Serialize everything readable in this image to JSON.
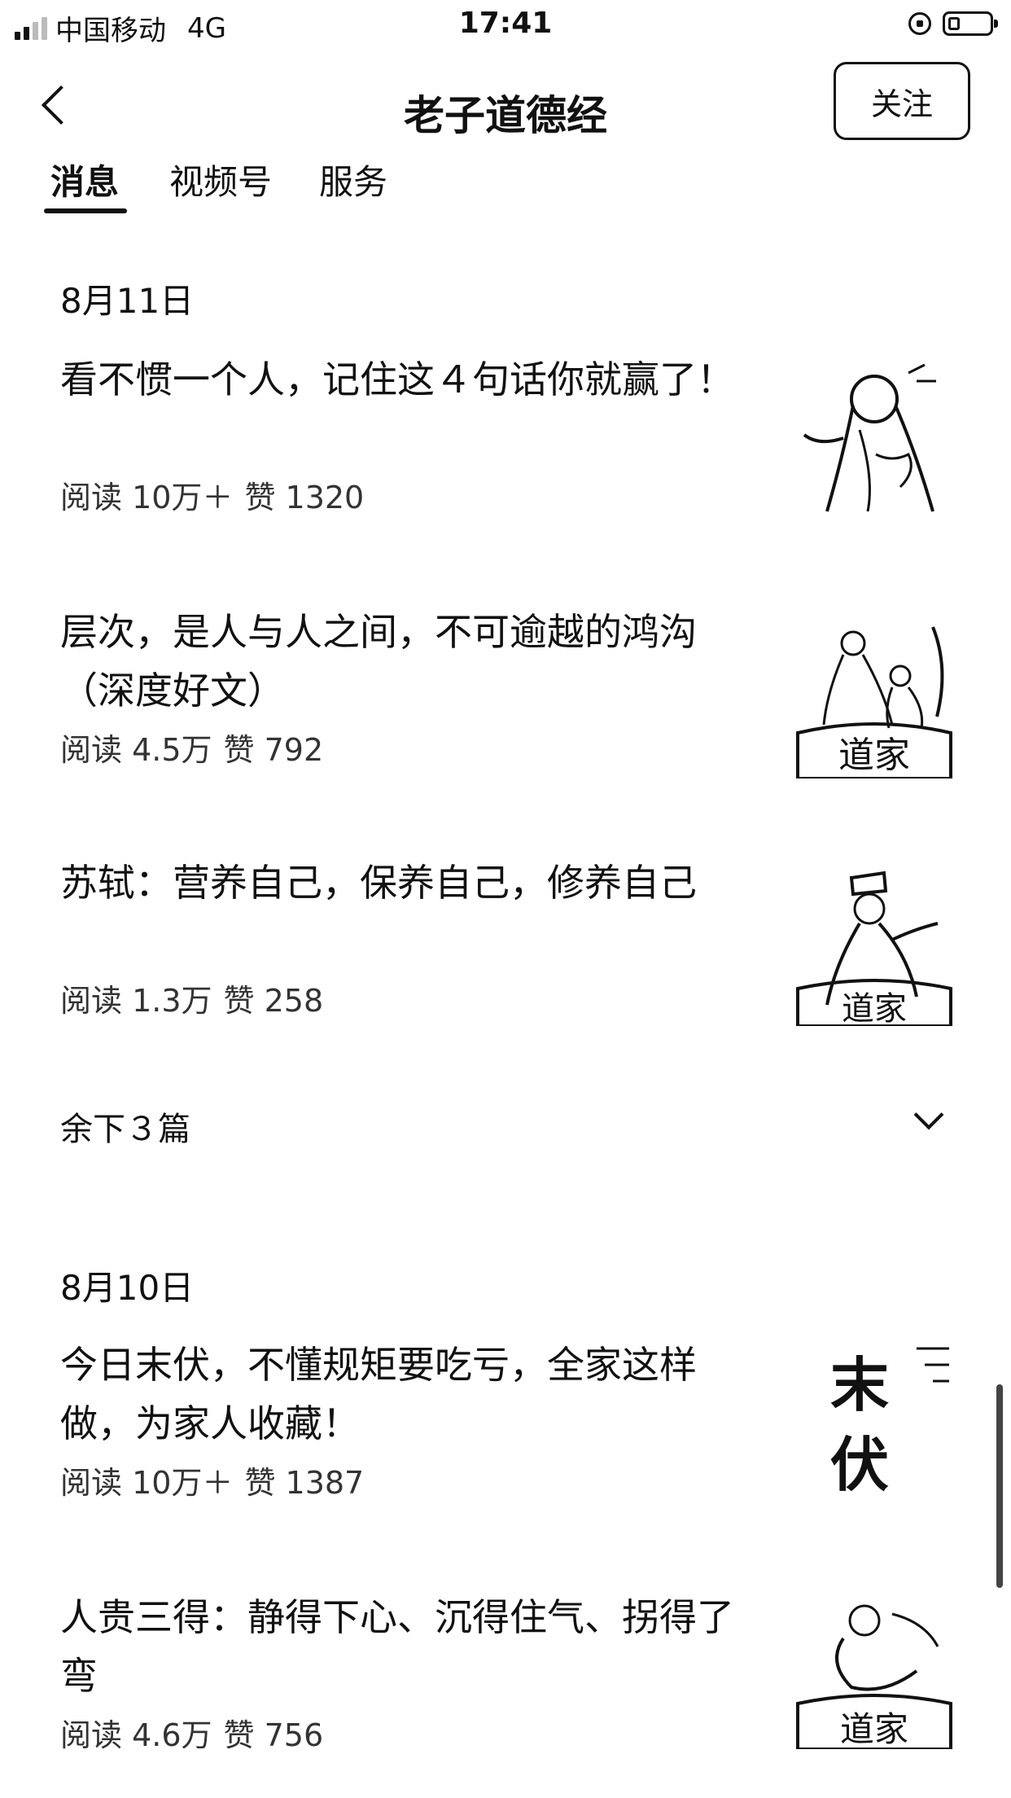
{
  "status": {
    "carrier": "中国移动",
    "network": "4G",
    "time": "17:41"
  },
  "nav": {
    "title": "老子道德经",
    "follow_label": "关注"
  },
  "tabs": [
    {
      "label": "消息"
    },
    {
      "label": "视频号"
    },
    {
      "label": "服务"
    }
  ],
  "groups": [
    {
      "date": "8月11日",
      "articles": [
        {
          "title": "看不惯一个人，记住这４句话你就赢了！",
          "reads": "阅读 10万＋",
          "likes": "赞 1320"
        },
        {
          "title": "层次，是人与人之间，不可逾越的鸿沟（深度好文）",
          "reads": "阅读 4.5万",
          "likes": "赞 792"
        },
        {
          "title": "苏轼：营养自己，保养自己，修养自己",
          "reads": "阅读 1.3万",
          "likes": "赞 258"
        }
      ],
      "more_label": "余下３篇"
    },
    {
      "date": "8月10日",
      "articles": [
        {
          "title": "今日末伏，不懂规矩要吃亏，全家这样做，为家人收藏！",
          "reads": "阅读 10万＋",
          "likes": "赞 1387",
          "thumb_text": [
            "末",
            "伏"
          ]
        },
        {
          "title": "人贵三得：静得下心、沉得住气、拐得了弯",
          "reads": "阅读 4.6万",
          "likes": "赞 756"
        }
      ]
    }
  ],
  "thumb_stamp_text": "道家"
}
